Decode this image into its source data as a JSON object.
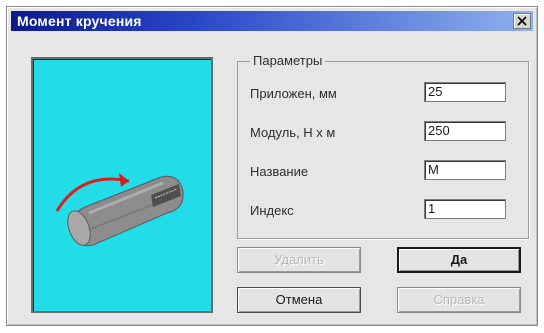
{
  "window": {
    "title": "Момент кручения",
    "close_label": "×"
  },
  "params": {
    "group_title": "Параметры",
    "fields": [
      {
        "label": "Приложен, мм",
        "value": "25"
      },
      {
        "label": "Модуль, Н х м",
        "value": "250"
      },
      {
        "label": "Название",
        "value": "M"
      },
      {
        "label": "Индекс",
        "value": "1"
      }
    ]
  },
  "buttons": {
    "delete": "Удалить",
    "ok": "Да",
    "cancel": "Отмена",
    "help": "Справка"
  },
  "colors": {
    "title_bar_dark": "#0c1a8c",
    "title_bar_light": "#8fb1ee",
    "preview_bg": "#22dce8",
    "torque_arrow": "#d62020"
  },
  "icons": {
    "preview": "torque-shaft-icon",
    "close": "close-icon"
  }
}
